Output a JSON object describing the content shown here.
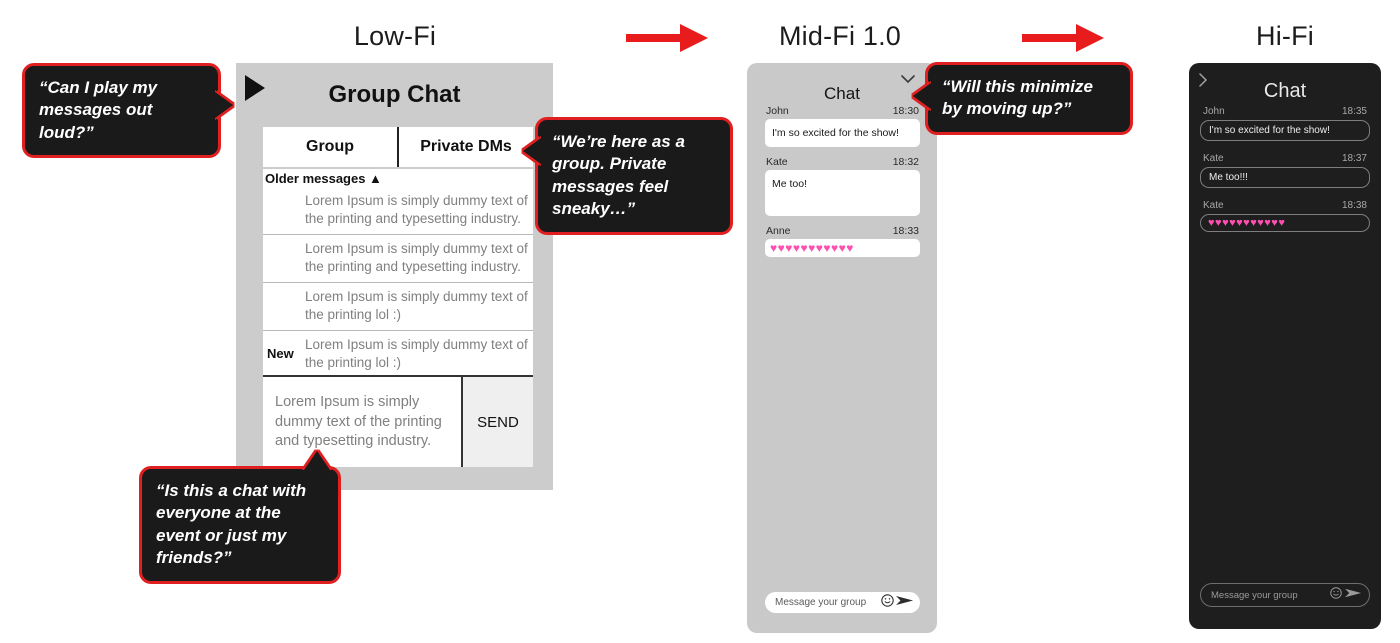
{
  "columns": {
    "lowfi_title": "Low-Fi",
    "midfi_title": "Mid-Fi 1.0",
    "hifi_title": "Hi-Fi"
  },
  "accent_color": "#e02020",
  "lowfi": {
    "play_icon": "play-icon",
    "heading": "Group Chat",
    "tabs": [
      {
        "label": "Group"
      },
      {
        "label": "Private DMs"
      }
    ],
    "older_label": "Older messages ▲",
    "messages": [
      {
        "badge": "",
        "text": "Lorem Ipsum is simply dummy text of the printing and typesetting industry."
      },
      {
        "badge": "",
        "text": "Lorem Ipsum is simply dummy text of the printing and typesetting industry."
      },
      {
        "badge": "",
        "text": "Lorem Ipsum is simply dummy text of the printing lol :)"
      },
      {
        "badge": "New",
        "text": "Lorem Ipsum is simply dummy text of the printing lol :)"
      }
    ],
    "compose_text": "Lorem Ipsum is simply dummy text of the printing and typesetting industry.",
    "send_label": "SEND"
  },
  "midfi": {
    "title": "Chat",
    "collapse_icon": "chevron-down-icon",
    "messages": [
      {
        "sender": "John",
        "time": "18:30",
        "text": "I'm so excited for the show!",
        "kind": "text"
      },
      {
        "sender": "Kate",
        "time": "18:32",
        "text": "Me too!",
        "kind": "text-tall"
      },
      {
        "sender": "Anne",
        "time": "18:33",
        "text": "♥♥♥♥♥♥♥♥♥♥♥",
        "kind": "emoji"
      }
    ],
    "compose_placeholder": "Message your group",
    "emoji_icon": "smiley-icon",
    "send_icon": "send-arrow-icon"
  },
  "hifi": {
    "title": "Chat",
    "back_icon": "chevron-right-icon",
    "messages": [
      {
        "sender": "John",
        "time": "18:35",
        "text": "I'm so excited for the show!",
        "kind": "text"
      },
      {
        "sender": "Kate",
        "time": "18:37",
        "text": "Me too!!!",
        "kind": "text"
      },
      {
        "sender": "Kate",
        "time": "18:38",
        "text": "♥♥♥♥♥♥♥♥♥♥♥",
        "kind": "emoji"
      }
    ],
    "compose_placeholder": "Message your group",
    "emoji_icon": "smiley-icon",
    "send_icon": "send-arrow-icon"
  },
  "callouts": [
    {
      "id": "callout-1",
      "text": "“Can I play my messages out loud?”"
    },
    {
      "id": "callout-2",
      "text": "“We’re here as a group.  Private messages feel sneaky…”"
    },
    {
      "id": "callout-3",
      "text": "“Is this a chat with everyone at the event or just my friends?”"
    },
    {
      "id": "callout-4",
      "text": "“Will this minimize by moving up?”"
    }
  ]
}
